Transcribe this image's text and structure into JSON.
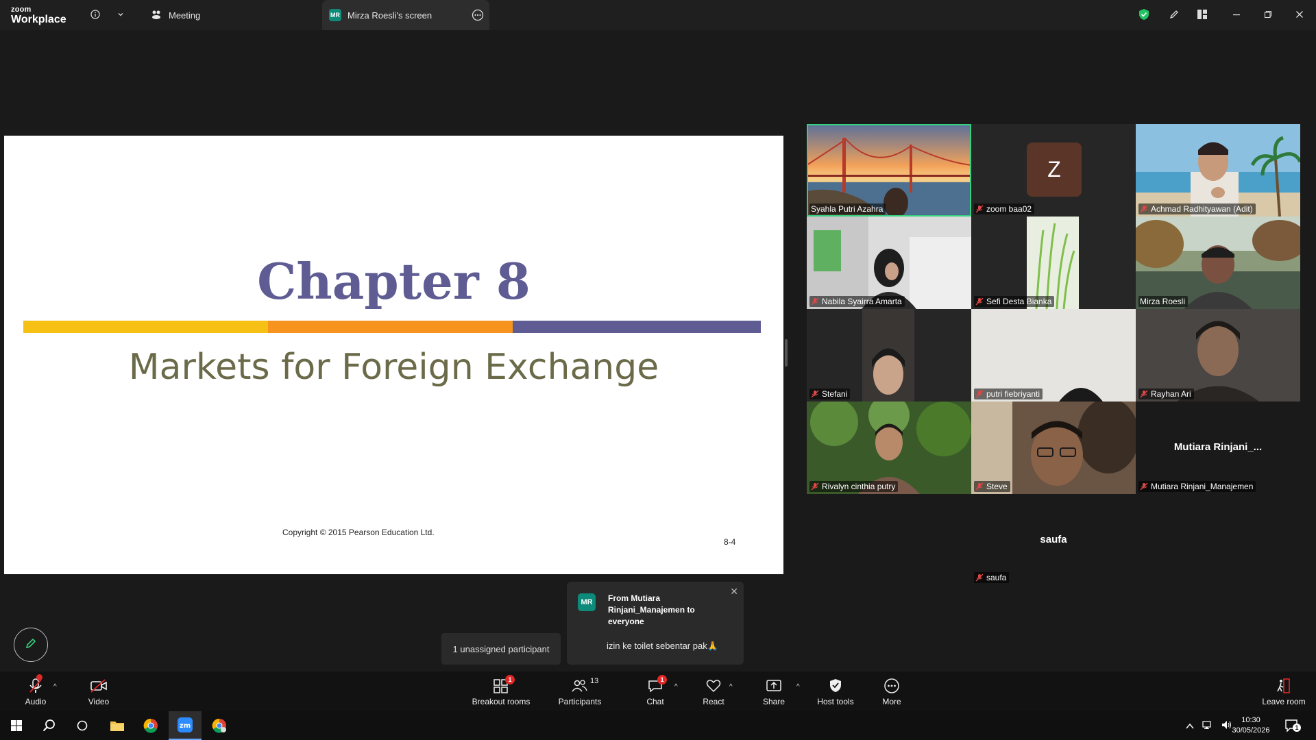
{
  "window": {
    "brand_line1": "zoom",
    "brand_line2": "Workplace",
    "tab_meeting": "Meeting",
    "tab_screen_initials": "MR",
    "tab_screen": "Mirza Roesli's screen"
  },
  "slide": {
    "title": "Chapter 8",
    "subtitle": "Markets for Foreign Exchange",
    "copyright": "Copyright © 2015 Pearson Education Ltd.",
    "page": "8-4",
    "bar_colors": [
      "#f6c114",
      "#f7941d",
      "#5e5c93"
    ],
    "title_color": "#5e5c93",
    "subtitle_color": "#6b6b4a"
  },
  "participants": [
    {
      "name": "Syahla Putri Azahra",
      "active": true
    },
    {
      "name": "zoom baa02",
      "avatar_letter": "Z"
    },
    {
      "name": "Achmad Radhityawan (Adit)"
    },
    {
      "name": "Nabila Syairra Amarta"
    },
    {
      "name": "Sefi Desta Bianka"
    },
    {
      "name": "Mirza Roesli",
      "muted": false
    },
    {
      "name": "Stefani"
    },
    {
      "name": "putri fiebriyanti"
    },
    {
      "name": "Rayhan Ari"
    },
    {
      "name": "Rivalyn cinthia putry"
    },
    {
      "name": "Steve"
    },
    {
      "name": "Mutiara Rinjani_Manajemen",
      "center_name": "Mutiara  Rinjani_..."
    },
    {
      "name": "saufa",
      "center_name": "saufa"
    }
  ],
  "popups": {
    "unassigned": "1 unassigned participant",
    "chat_avatar": "MR",
    "chat_from": "From Mutiara Rinjani_Manajemen to everyone",
    "chat_message": "izin ke toilet sebentar pak🙏"
  },
  "toolbar": {
    "audio": "Audio",
    "video": "Video",
    "breakout": "Breakout rooms",
    "breakout_badge": "1",
    "participants": "Participants",
    "participants_count": "13",
    "chat": "Chat",
    "chat_badge": "1",
    "react": "React",
    "share": "Share",
    "host_tools": "Host tools",
    "more": "More",
    "leave": "Leave room"
  },
  "taskbar": {
    "time": "10:30",
    "date": "30/05/2026",
    "notification_count": "1"
  }
}
